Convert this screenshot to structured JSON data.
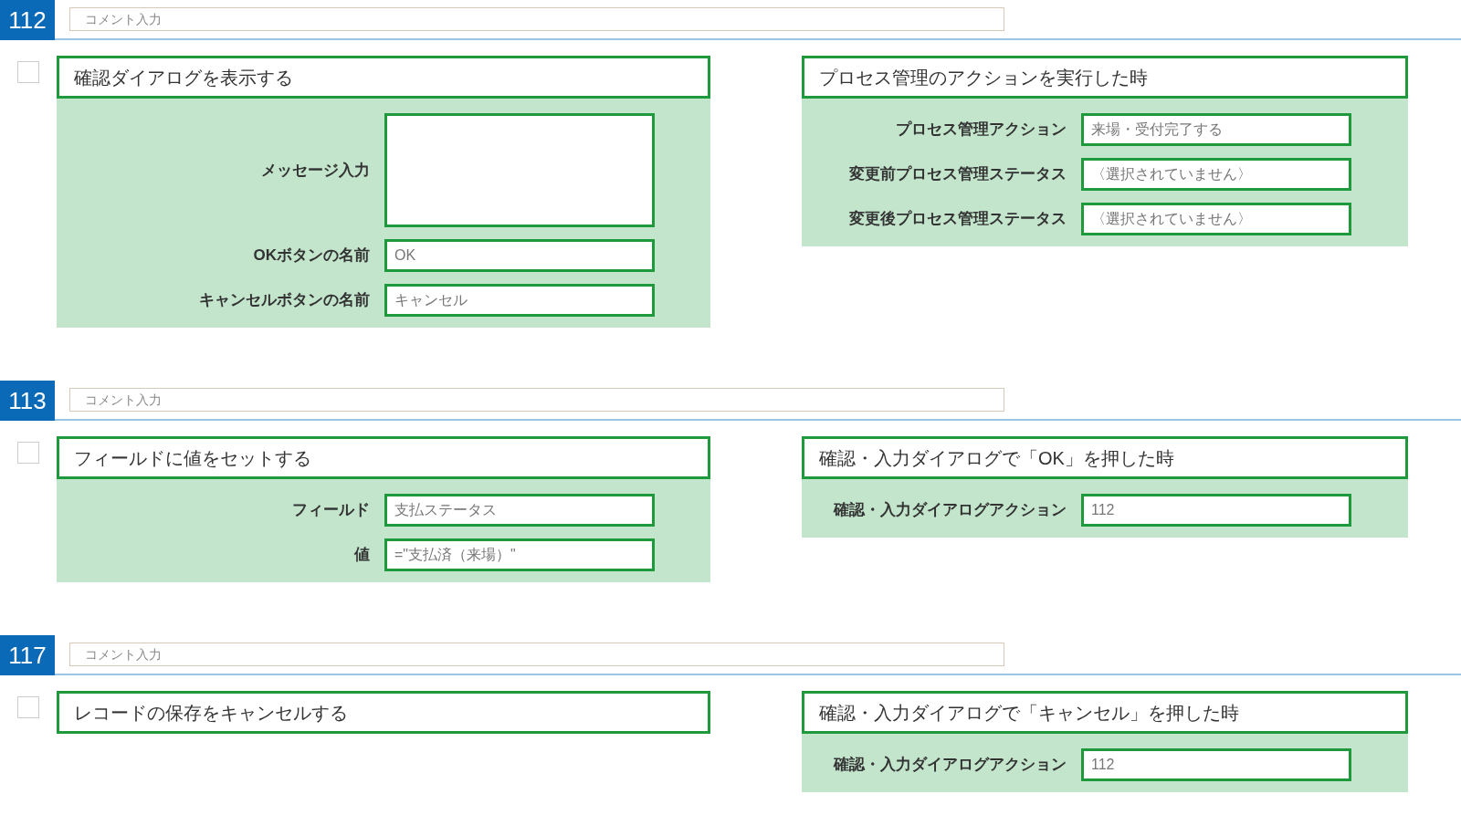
{
  "sections": [
    {
      "number": "112",
      "comment": {
        "placeholder": "コメント入力"
      },
      "checked": false,
      "action": {
        "title": "確認ダイアログを表示する",
        "fields": [
          {
            "kind": "textarea",
            "label": "メッセージ入力"
          },
          {
            "kind": "input",
            "label": "OKボタンの名前",
            "value": "OK"
          },
          {
            "kind": "input",
            "label": "キャンセルボタンの名前",
            "value": "キャンセル"
          }
        ]
      },
      "condition": {
        "title": "プロセス管理のアクションを実行した時",
        "fields": [
          {
            "kind": "input",
            "label": "プロセス管理アクション",
            "value": "来場・受付完了する"
          },
          {
            "kind": "input",
            "label": "変更前プロセス管理ステータス",
            "value": "〈選択されていません〉"
          },
          {
            "kind": "input",
            "label": "変更後プロセス管理ステータス",
            "value": "〈選択されていません〉"
          }
        ]
      }
    },
    {
      "number": "113",
      "comment": {
        "placeholder": "コメント入力"
      },
      "checked": false,
      "action": {
        "title": "フィールドに値をセットする",
        "fields": [
          {
            "kind": "input",
            "label": "フィールド",
            "value": "支払ステータス"
          },
          {
            "kind": "input",
            "label": "値",
            "value": "=\"支払済（来場）\""
          }
        ]
      },
      "condition": {
        "title": "確認・入力ダイアログで「OK」を押した時",
        "fields": [
          {
            "kind": "input",
            "label": "確認・入力ダイアログアクション",
            "value": "112"
          }
        ]
      }
    },
    {
      "number": "117",
      "comment": {
        "placeholder": "コメント入力"
      },
      "checked": false,
      "action": {
        "title": "レコードの保存をキャンセルする"
      },
      "condition": {
        "title": "確認・入力ダイアログで「キャンセル」を押した時",
        "fields": [
          {
            "kind": "input",
            "label": "確認・入力ダイアログアクション",
            "value": "112"
          }
        ]
      }
    }
  ]
}
